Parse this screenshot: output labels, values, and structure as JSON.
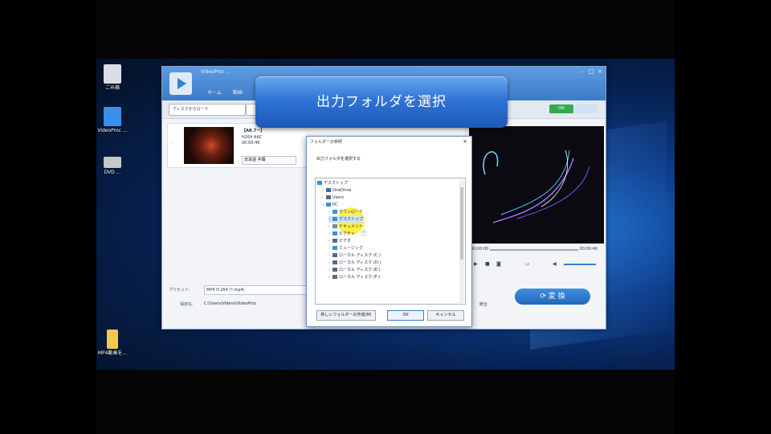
{
  "desktop": {
    "icons": [
      {
        "label": "ごみ箱",
        "icon": "recycle-bin-icon",
        "color": "#d8dde6"
      },
      {
        "label": "VideoProc ...",
        "icon": "app-shortcut-icon",
        "color": "#3a8ee8"
      },
      {
        "label": "DVD ...",
        "icon": "dvd-shortcut-icon",
        "color": "#c7c7c7"
      },
      {
        "label": "MP4動画を...",
        "icon": "folder-icon",
        "color": "#f2c94c"
      }
    ]
  },
  "app": {
    "title": "VideoProc ...",
    "tabs": [
      "ホーム",
      "動画"
    ],
    "toolbar": {
      "add_button": "ディスクからロード",
      "toggle_label": "ON"
    },
    "file_item": {
      "name": "【AR.7ー】",
      "meta1": "H264 AAC",
      "meta2": "00:00:46",
      "dropdown": "日本語 字幕"
    },
    "preview": {
      "time_start": "00:00:00",
      "time_end": "00:00:46"
    },
    "output": {
      "preset_label": "プリセット:",
      "preset_value": "MP4 H.264 (*.mp4)",
      "folder_label": "保存先:",
      "folder_value": "C:\\Users\\Videos\\VideoProc",
      "merge_label": "統合"
    },
    "convert_button": "変 換"
  },
  "banner": {
    "text": "出力フォルダを選択"
  },
  "dialog": {
    "title": "フォルダーの参照",
    "prompt": "出力フォルダを選択する",
    "tree": [
      {
        "label": "デスクトップ",
        "level": 0,
        "icon": "desktop-icon",
        "color": "#3b8fd8"
      },
      {
        "label": "OneDrive",
        "level": 1,
        "icon": "cloud-icon",
        "color": "#2c6fbf"
      },
      {
        "label": "Users",
        "level": 1,
        "icon": "user-icon",
        "color": "#5a6b80"
      },
      {
        "label": "PC",
        "level": 1,
        "icon": "pc-icon",
        "color": "#3b8fd8"
      },
      {
        "label": "ダウンロード",
        "level": 2,
        "icon": "download-icon",
        "color": "#3b8fd8"
      },
      {
        "label": "デスクトップ",
        "level": 2,
        "icon": "desktop-icon",
        "color": "#3b8fd8"
      },
      {
        "label": "ドキュメント",
        "level": 2,
        "icon": "documents-icon",
        "color": "#7a8a9c"
      },
      {
        "label": "ピクチャ",
        "level": 2,
        "icon": "pictures-icon",
        "color": "#3b8fd8"
      },
      {
        "label": "ビデオ",
        "level": 2,
        "icon": "video-icon",
        "color": "#5a6b80"
      },
      {
        "label": "ミュージック",
        "level": 2,
        "icon": "music-icon",
        "color": "#3b8fd8"
      },
      {
        "label": "ローカル ディスク (C:)",
        "level": 2,
        "icon": "drive-icon",
        "color": "#5a6b80"
      },
      {
        "label": "ローカル ディスク (D:)",
        "level": 2,
        "icon": "drive-icon",
        "color": "#5a6b80"
      },
      {
        "label": "ローカル ディスク (E:)",
        "level": 2,
        "icon": "drive-icon",
        "color": "#5a6b80"
      },
      {
        "label": "ローカル ディスク (F:)",
        "level": 2,
        "icon": "drive-icon",
        "color": "#5a6b80"
      }
    ],
    "new_folder_button": "新しいフォルダーの作成(M)",
    "ok_button": "OK",
    "cancel_button": "キャンセル"
  }
}
